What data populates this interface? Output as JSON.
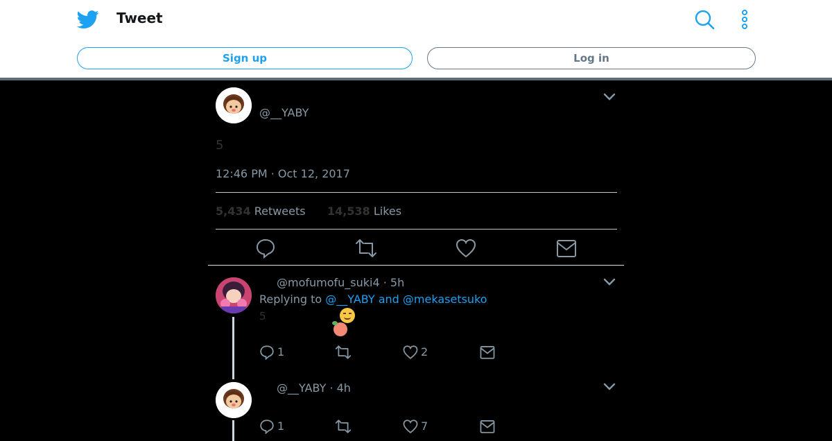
{
  "header": {
    "title": "Tweet",
    "signup_label": "Sign up",
    "login_label": "Log in"
  },
  "main_tweet": {
    "handle": "@__YABY",
    "avatar_text": "YABY",
    "text": "5",
    "timestamp": "12:46 PM · Oct 12, 2017",
    "retweets_count": "5,434",
    "retweets_label": "Retweets",
    "likes_count": "14,538",
    "likes_label": "Likes"
  },
  "replies": [
    {
      "handle_time": "@mofumofu_suki4 · 5h",
      "replying_prefix": "Replying to",
      "replying_to": "@__YABY and @mekasetsuko",
      "text": "5",
      "reply_count": "1",
      "retweet_count": "",
      "like_count": "2"
    },
    {
      "handle_time": "@__YABY · 4h",
      "avatar_text": "YABY",
      "reply_count": "1",
      "retweet_count": "",
      "like_count": "7"
    }
  ],
  "icons": [
    "twitter-bird-icon",
    "search-icon",
    "more-vertical-icon",
    "chevron-down-icon",
    "reply-icon",
    "retweet-icon",
    "like-icon",
    "dm-icon"
  ],
  "colors": {
    "accent": "#1da1f2",
    "muted": "#8899a6",
    "background": "#000000"
  }
}
